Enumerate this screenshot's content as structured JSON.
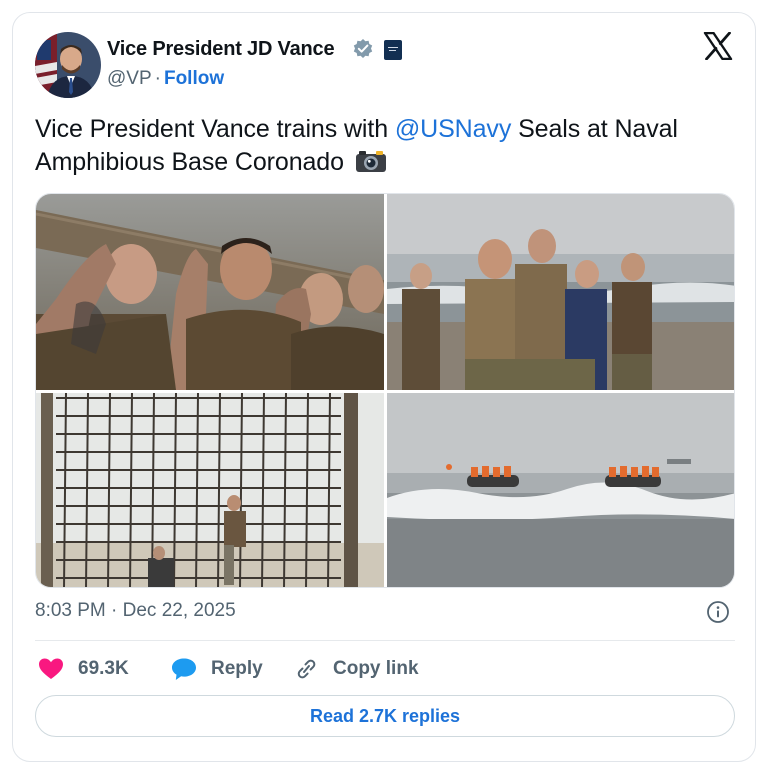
{
  "author": {
    "display_name": "Vice President JD Vance",
    "handle": "@VP",
    "separator": "·",
    "follow_label": "Follow"
  },
  "tweet": {
    "text_before": "Vice President Vance trains with ",
    "mention": "@USNavy",
    "text_after": " Seals at Naval Amphibious Base Coronado"
  },
  "timestamp": "8:03 PM · Dec 22, 2025",
  "actions": {
    "likes": "69.3K",
    "reply_label": "Reply",
    "copy_link_label": "Copy link"
  },
  "read_replies_label": "Read 2.7K replies",
  "colors": {
    "link": "#1d72d8",
    "like": "#f91880",
    "muted": "#536471",
    "text": "#0f1419"
  },
  "icons": [
    "verified-badge-icon",
    "government-affiliation-icon",
    "x-logo-icon",
    "camera-emoji-icon",
    "info-icon",
    "heart-icon",
    "reply-bubble-icon",
    "link-icon"
  ]
}
